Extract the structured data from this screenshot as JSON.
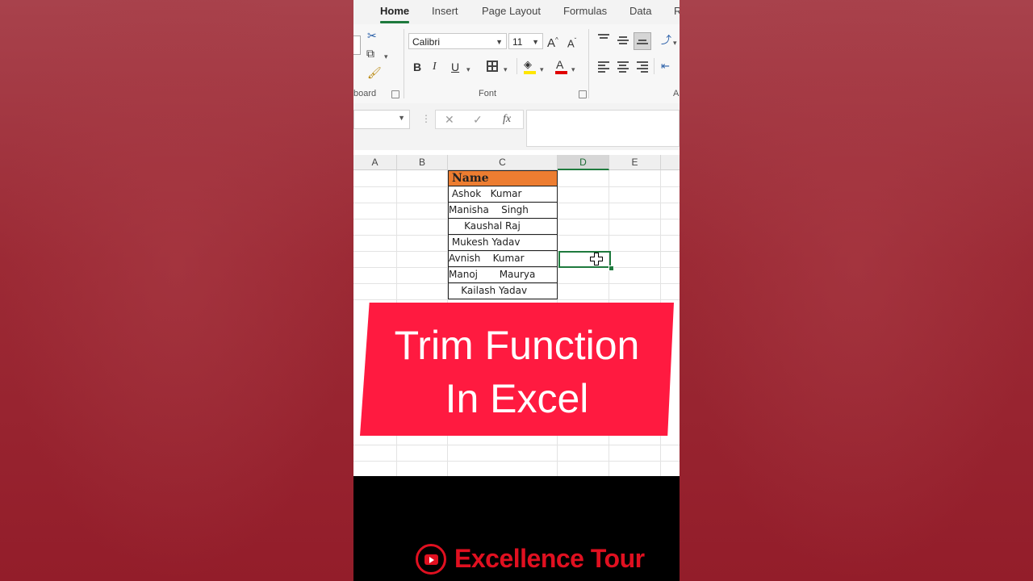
{
  "ribbon": {
    "tabs": [
      {
        "label": "Home",
        "active": true
      },
      {
        "label": "Insert"
      },
      {
        "label": "Page Layout"
      },
      {
        "label": "Formulas"
      },
      {
        "label": "Data"
      },
      {
        "label": "R"
      }
    ],
    "clipboard_label_partial": "board",
    "font": {
      "group_label": "Font",
      "font_name": "Calibri",
      "font_size": "11",
      "buttons": [
        "bold",
        "italic",
        "underline",
        "borders",
        "fill-color",
        "font-color"
      ],
      "bold_glyph": "B",
      "italic_glyph": "I",
      "underline_glyph": "U",
      "font_color_glyph": "A"
    },
    "alignment_label_partial": "A"
  },
  "formula_bar": {
    "name_box": "",
    "formula": ""
  },
  "sheet": {
    "columns": [
      "A",
      "B",
      "C",
      "D",
      "E"
    ],
    "selected_column": "D",
    "header_cell": "Name",
    "names": [
      " Ashok   Kumar",
      "Manisha    Singh",
      "     Kaushal Raj",
      " Mukesh Yadav",
      "Avnish    Kumar",
      "Manoj       Maurya",
      "    Kailash Yadav"
    ]
  },
  "banner": {
    "line1": "Trim Function",
    "line2": "In Excel"
  },
  "footer": {
    "channel": "Excellence Tour"
  },
  "colors": {
    "background": "#9c2a35",
    "header_fill": "#ed7d31",
    "banner": "#ff1a40",
    "excel_green": "#1f7a3e",
    "channel_red": "#e01020"
  }
}
